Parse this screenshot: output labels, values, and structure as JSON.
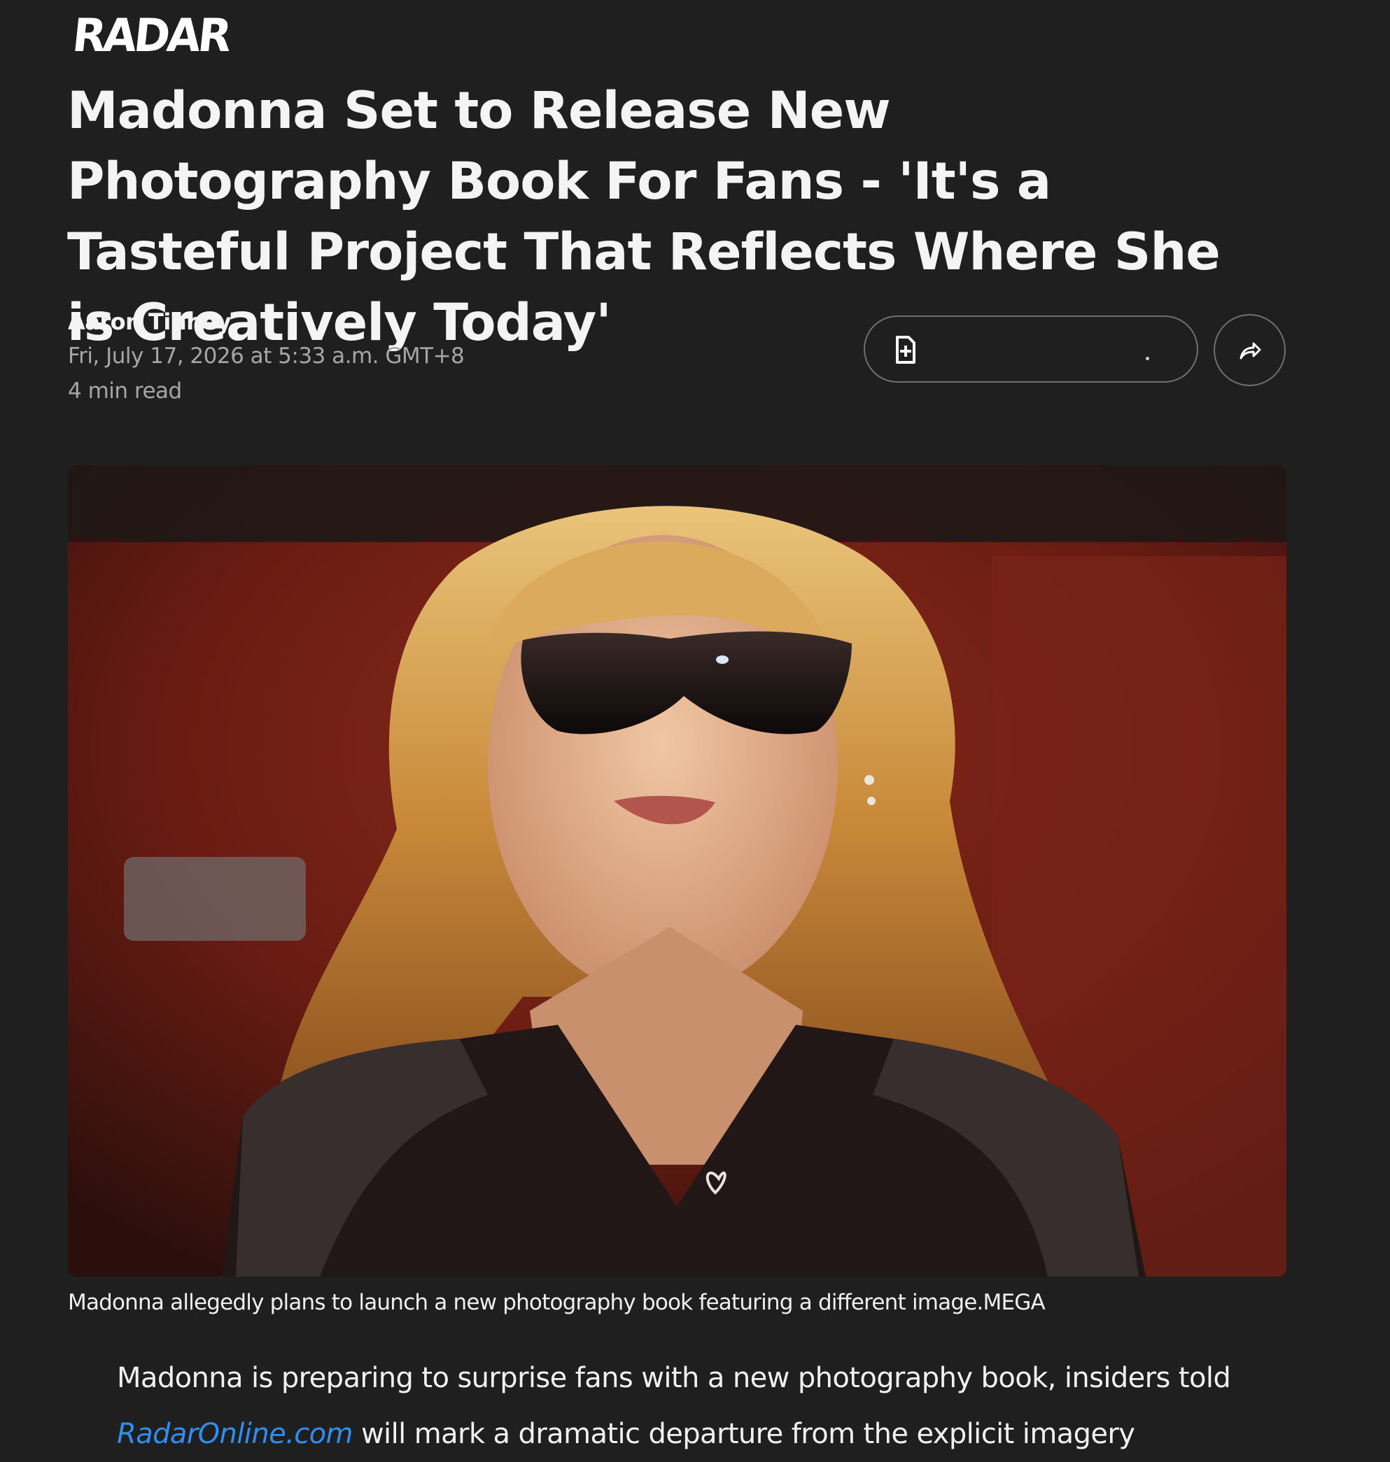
{
  "site": {
    "logo": "RADAR"
  },
  "article": {
    "headline": "Madonna Set to Release New Photography Book For Fans - 'It's a Tasteful Project That Reflects Where She is Creatively Today'",
    "author": "Aaron Tinney",
    "date": "Fri, July 17, 2026 at 5:33 a.m. GMT+8",
    "read_time": "4 min read",
    "image_caption": "Madonna allegedly plans to launch a new photography book featuring a different image.MEGA",
    "body": {
      "intro": "Madonna is preparing to surprise fans with a new photography book, insiders told",
      "link_text": "RadarOnline.com",
      "continuation": " will mark a dramatic departure from the explicit imagery"
    }
  },
  "actions": {
    "save_icon": "bookmark-add-icon",
    "share_icon": "share-arrow-icon"
  },
  "colors": {
    "background": "#1f1f1f",
    "link": "#2f8ef0",
    "muted_text": "#a6a6a6"
  }
}
